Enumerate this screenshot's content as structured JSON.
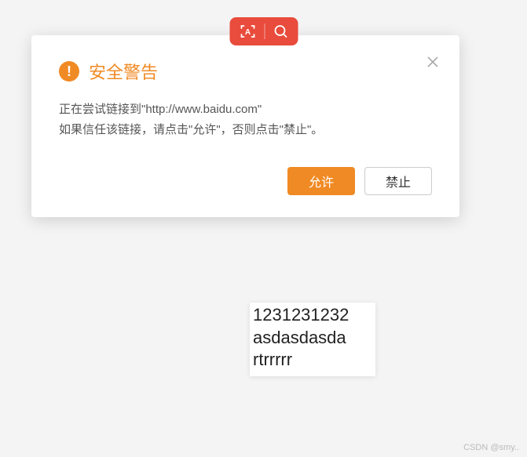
{
  "dialog": {
    "title": "安全警告",
    "warning_mark": "!",
    "body_line1": "正在尝试链接到\"http://www.baidu.com\"",
    "body_line2": "如果信任该链接，请点击\"允许\"，否则点击\"禁止\"。",
    "allow_label": "允许",
    "deny_label": "禁止"
  },
  "text_block": {
    "line1": "1231231232",
    "line2": "asdasdasda",
    "line3": "rtrrrrr"
  },
  "watermark": "CSDN @smy.."
}
